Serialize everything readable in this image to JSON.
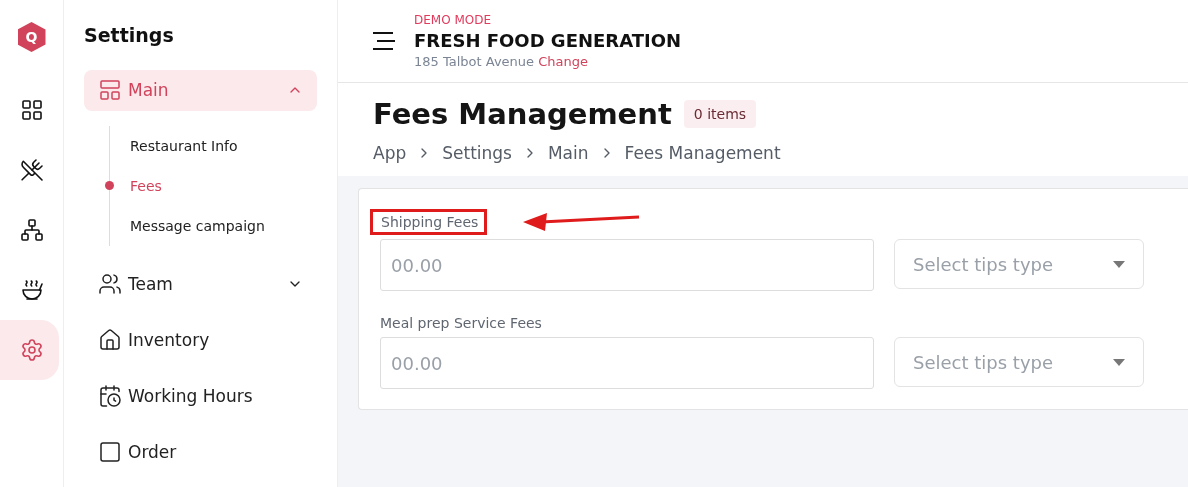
{
  "logo": {
    "letter": "Q"
  },
  "rail": [
    {
      "kind": "dashboard",
      "selected": false
    },
    {
      "kind": "utensils",
      "selected": false
    },
    {
      "kind": "hierarchy",
      "selected": false
    },
    {
      "kind": "bowl",
      "selected": false
    },
    {
      "kind": "settings",
      "selected": true
    }
  ],
  "sidebar": {
    "title": "Settings",
    "items": [
      {
        "label": "Main",
        "expanded": true,
        "selected": true,
        "children": [
          {
            "label": "Restaurant Info",
            "selected": false
          },
          {
            "label": "Fees",
            "selected": true
          },
          {
            "label": "Message campaign",
            "selected": false
          }
        ]
      },
      {
        "label": "Team",
        "expanded": false,
        "selected": false
      },
      {
        "label": "Inventory",
        "selected": false
      },
      {
        "label": "Working Hours",
        "selected": false
      },
      {
        "label": "Order",
        "selected": false
      }
    ]
  },
  "header": {
    "mode": "DEMO MODE",
    "restaurant": "FRESH FOOD GENERATION",
    "address": "185 Talbot Avenue",
    "change_link": "Change"
  },
  "page": {
    "title": "Fees Management",
    "count_badge": "0 items",
    "breadcrumb": [
      "App",
      "Settings",
      "Main",
      "Fees Management"
    ]
  },
  "fees": [
    {
      "label": "Shipping Fees",
      "highlighted": true,
      "placeholder": "00.00",
      "select_placeholder": "Select tips type"
    },
    {
      "label": "Meal prep Service Fees",
      "highlighted": false,
      "placeholder": "00.00",
      "select_placeholder": "Select tips type"
    }
  ]
}
